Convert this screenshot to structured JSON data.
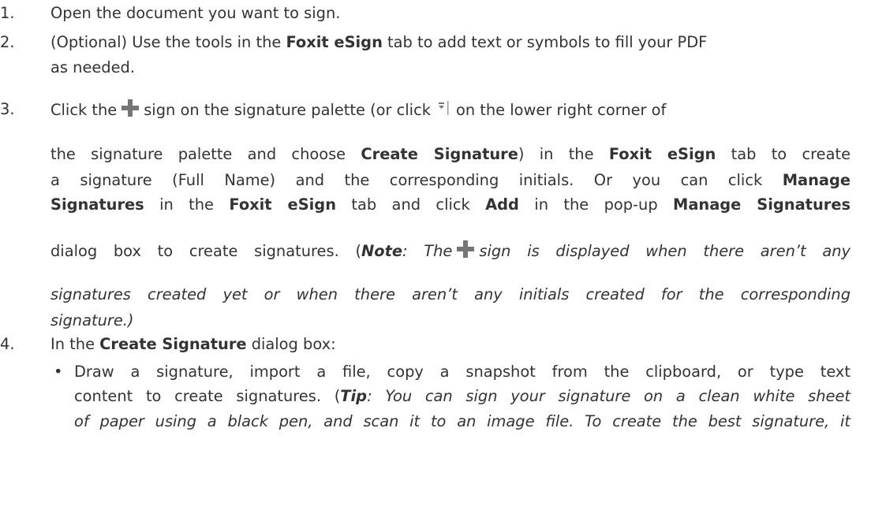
{
  "steps": [
    {
      "num": "1.",
      "text": "Open the document you want to sign."
    },
    {
      "num": "2.",
      "line1": {
        "a": "(Optional) Use the tools in the ",
        "b": "Foxit eSign",
        "c": " tab to add text or symbols to fill your PDF"
      },
      "line2": "as needed."
    },
    {
      "num": "3.",
      "line1": {
        "a": "Click the",
        "b": "sign on the signature palette (or click",
        "c": "on the lower right corner of"
      },
      "line2": {
        "a": "the signature palette and choose ",
        "b": "Create Signature",
        "c": ") in the ",
        "d": "Foxit eSign",
        "e": " tab to create"
      },
      "line3": {
        "a": "a signature (Full Name) and the corresponding initials. Or you can click ",
        "b": "Manage"
      },
      "line4": {
        "a": "Signatures",
        "b": " in the ",
        "c": "Foxit eSign",
        "d": " tab and click ",
        "e": "Add",
        "f": " in the pop-up ",
        "g": "Manage Signatures"
      },
      "line5": {
        "a": "dialog box to create signatures. (",
        "b": "Note",
        "c": ": The",
        "d": "sign is displayed when there aren’t any"
      },
      "line6": "signatures created yet or when there aren’t any initials created for the corresponding",
      "line7": "signature.)"
    },
    {
      "num": "4.",
      "line1": {
        "a": "In the ",
        "b": "Create Signature",
        "c": " dialog box:"
      },
      "bullet": "•",
      "sub1": "Draw a signature, import a file, copy a snapshot from the clipboard, or type text",
      "sub2": {
        "a": "content to create signatures. (",
        "b": "Tip",
        "c": ": You can sign your signature on a clean white sheet"
      },
      "sub3": "of paper using a black pen, and scan it to an image file. To create the best signature, it"
    }
  ],
  "icons": {
    "plus": "plus-icon",
    "palette_menu": "chevron-down-icon",
    "plus_color": "#757575"
  }
}
